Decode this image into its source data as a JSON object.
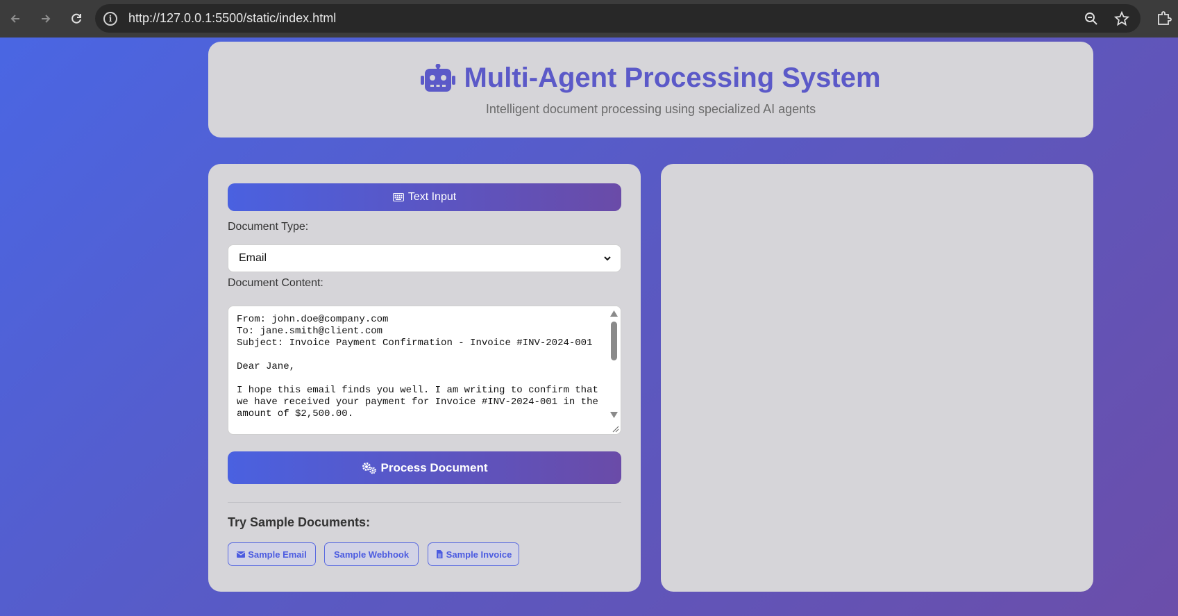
{
  "browser": {
    "url": "http://127.0.0.1:5500/static/index.html"
  },
  "header": {
    "title": "Multi-Agent Processing System",
    "subtitle": "Intelligent document processing using specialized AI agents"
  },
  "input_panel": {
    "tab_label": "Text Input",
    "document_type_label": "Document Type:",
    "document_type_value": "Email",
    "document_content_label": "Document Content:",
    "document_content": "From: john.doe@company.com\nTo: jane.smith@client.com\nSubject: Invoice Payment Confirmation - Invoice #INV-2024-001\n\nDear Jane,\n\nI hope this email finds you well. I am writing to confirm that we have received your payment for Invoice #INV-2024-001 in the amount of $2,500.00.",
    "process_button": "Process Document",
    "samples_title": "Try Sample Documents:",
    "samples": [
      {
        "label": "Sample Email",
        "icon": "envelope-icon"
      },
      {
        "label": "Sample Webhook",
        "icon": ""
      },
      {
        "label": "Sample Invoice",
        "icon": "file-icon"
      }
    ]
  },
  "colors": {
    "accent": "#5b59c8",
    "gradient_start": "#4a61e0",
    "gradient_end": "#6a4ba8",
    "card_bg": "#d6d5d9"
  }
}
